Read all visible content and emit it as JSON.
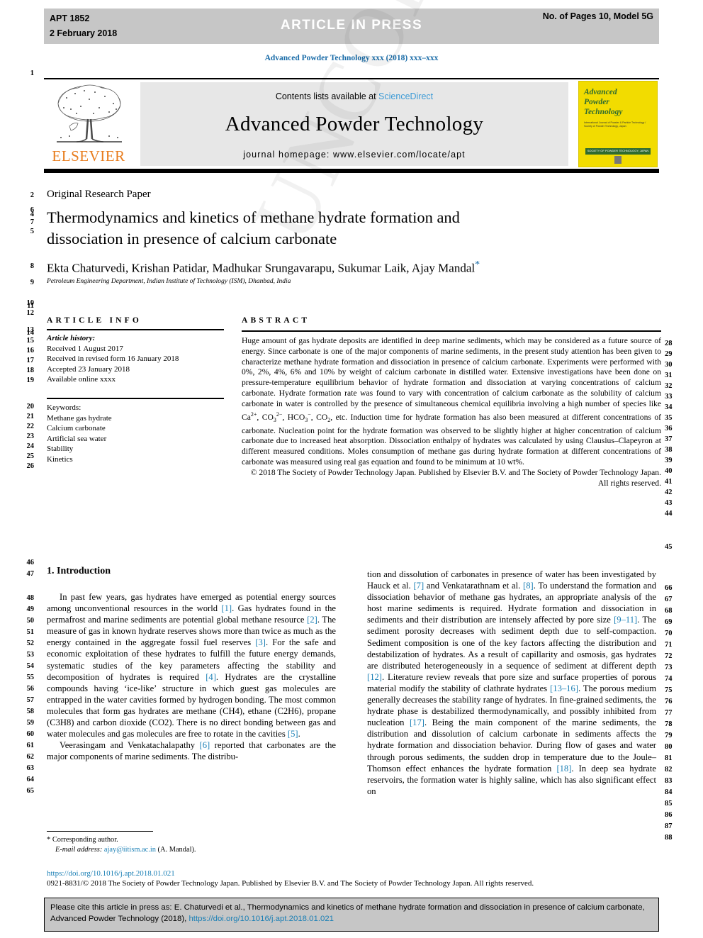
{
  "banner": {
    "left_code": "APT 1852",
    "left_date": "2 February 2018",
    "center": "ARTICLE  IN  PRESS",
    "right": "No. of Pages 10, Model 5G"
  },
  "running_head": "Advanced Powder Technology xxx (2018) xxx–xxx",
  "masthead": {
    "elsevier_wordmark": "ELSEVIER",
    "contents_prefix": "Contents lists available at ",
    "contents_link": "ScienceDirect",
    "journal_name": "Advanced Powder Technology",
    "homepage": "journal homepage: www.elsevier.com/locate/apt",
    "cover_title": "Advanced\nPowder\nTechnology",
    "cover_sub": "International Journal of Powder & Particle Technology / Society of Powder Technology, Japan",
    "cover_band_text": "SOCIETY OF POWDER TECHNOLOGY, JAPAN"
  },
  "article": {
    "type": "Original Research Paper",
    "title_line1": "Thermodynamics and kinetics of methane hydrate formation and",
    "title_line2": "dissociation in presence of calcium carbonate",
    "authors": "Ekta Chaturvedi, Krishan Patidar, Madhukar Srungavarapu, Sukumar Laik, Ajay Mandal",
    "corresponding_marker": "*",
    "affiliation": "Petroleum Engineering Department, Indian Institute of Technology (ISM), Dhanbad, India"
  },
  "info": {
    "heading": "ARTICLE INFO",
    "history_label": "Article history:",
    "history": [
      "Received 1 August 2017",
      "Received in revised form 16 January 2018",
      "Accepted 23 January 2018",
      "Available online xxxx"
    ],
    "keywords_label": "Keywords:",
    "keywords": [
      "Methane gas hydrate",
      "Calcium carbonate",
      "Artificial sea water",
      "Stability",
      "Kinetics"
    ]
  },
  "abstract": {
    "heading": "ABSTRACT",
    "body": "Huge amount of gas hydrate deposits are identified in deep marine sediments, which may be considered as a future source of energy. Since carbonate is one of the major components of marine sediments, in the present study attention has been given to characterize methane hydrate formation and dissociation in presence of calcium carbonate. Experiments were performed with 0%, 2%, 4%, 6% and 10% by weight of calcium carbonate in distilled water. Extensive investigations have been done on pressure-temperature equilibrium behavior of hydrate formation and dissociation at varying concentrations of calcium carbonate. Hydrate formation rate was found to vary with concentration of calcium carbonate as the solubility of calcium carbonate in water is controlled by the presence of simultaneous chemical equilibria involving a high number of species like Ca2+, CO32−, HCO3−, CO2, etc. Induction time for hydrate formation has also been measured at different concentrations of carbonate. Nucleation point for the hydrate formation was observed to be slightly higher at higher concentration of calcium carbonate due to increased heat absorption. Dissociation enthalpy of hydrates was calculated by using Clausius–Clapeyron at different measured conditions. Moles consumption of methane gas during hydrate formation at different concentrations of carbonate was measured using real gas equation and found to be minimum at 10 wt%.",
    "copyright": "© 2018 The Society of Powder Technology Japan. Published by Elsevier B.V. and The Society of Powder Technology Japan. All rights reserved."
  },
  "introduction": {
    "heading": "1. Introduction",
    "left_p1": "In past few years, gas hydrates have emerged as potential energy sources among unconventional resources in the world [1]. Gas hydrates found in the permafrost and marine sediments are potential global methane resource [2]. The measure of gas in known hydrate reserves shows more than twice as much as the energy contained in the aggregate fossil fuel reserves [3]. For the safe and economic exploitation of these hydrates to fulfill the future energy demands, systematic studies of the key parameters affecting the stability and decomposition of hydrates is required [4]. Hydrates are the crystalline compounds having 'ice-like' structure in which guest gas molecules are entrapped in the water cavities formed by hydrogen bonding. The most common molecules that form gas hydrates are methane (CH4), ethane (C2H6), propane (C3H8) and carbon dioxide (CO2). There is no direct bonding between gas and water molecules and gas molecules are free to rotate in the cavities [5].",
    "left_p2": "Veerasingam and Venkatachalapathy [6] reported that carbonates are the major components of marine sediments. The distribu-",
    "right_p1": "tion and dissolution of carbonates in presence of water has been investigated by Hauck et al. [7] and Venkatarathnam et al. [8]. To understand the formation and dissociation behavior of methane gas hydrates, an appropriate analysis of the host marine sediments is required. Hydrate formation and dissociation in sediments and their distribution are intensely affected by pore size [9–11]. The sediment porosity decreases with sediment depth due to self-compaction. Sediment composition is one of the key factors affecting the distribution and destabilization of hydrates. As a result of capillarity and osmosis, gas hydrates are distributed heterogeneously in a sequence of sediment at different depth [12]. Literature review reveals that pore size and surface properties of porous material modify the stability of clathrate hydrates [13–16]. The porous medium generally decreases the stability range of hydrates. In fine-grained sediments, the hydrate phase is destabilized thermodynamically, and possibly inhibited from nucleation [17]. Being the main component of the marine sediments, the distribution and dissolution of calcium carbonate in sediments affects the hydrate formation and dissociation behavior. During flow of gases and water through porous sediments, the sudden drop in temperature due to the Joule–Thomson effect enhances the hydrate formation [18]. In deep sea hydrate reservoirs, the formation water is highly saline, which has also significant effect on"
  },
  "footnote": {
    "star": "*",
    "corresponding": "Corresponding author.",
    "email_label": "E-mail address:",
    "email": "ajay@iitism.ac.in",
    "email_suffix": " (A. Mandal)."
  },
  "doi": "https://doi.org/10.1016/j.apt.2018.01.021",
  "issn_line": "0921-8831/© 2018 The Society of Powder Technology Japan. Published by Elsevier B.V. and The Society of Powder Technology Japan. All rights reserved.",
  "citation_footer": {
    "text_before_link": "Please cite this article in press as: E. Chaturvedi et al., Thermodynamics and kinetics of methane hydrate formation and dissociation in presence of calcium carbonate, Advanced Powder Technology (2018), ",
    "link": "https://doi.org/10.1016/j.apt.2018.01.021"
  },
  "watermark": "UNCORRECTED PROOF",
  "line_numbers": {
    "left": [
      "1",
      "2",
      "6",
      "4",
      "7",
      "5",
      "8",
      "9",
      "10",
      "11",
      "12",
      "13",
      "14",
      "15",
      "16",
      "17",
      "18",
      "19",
      "20",
      "21",
      "22",
      "23",
      "24",
      "25",
      "26",
      "46",
      "47",
      "48",
      "49",
      "50",
      "51",
      "52",
      "53",
      "54",
      "55",
      "56",
      "57",
      "58",
      "59",
      "60",
      "61",
      "62",
      "63",
      "64",
      "65"
    ],
    "right": [
      "28",
      "29",
      "30",
      "31",
      "32",
      "33",
      "34",
      "35",
      "36",
      "37",
      "38",
      "39",
      "40",
      "41",
      "42",
      "43",
      "44",
      "45",
      "66",
      "67",
      "68",
      "69",
      "70",
      "71",
      "72",
      "73",
      "74",
      "75",
      "76",
      "77",
      "78",
      "79",
      "80",
      "81",
      "82",
      "83",
      "84",
      "85",
      "86",
      "87",
      "88"
    ]
  },
  "colors": {
    "link_blue": "#1a7fb5",
    "banner_grey": "#c6c6c6",
    "masthead_grey": "#e7e7e7",
    "elsevier_orange": "#e87d1e",
    "cover_yellow": "#f2dc00",
    "cover_green": "#2f6b2f"
  }
}
